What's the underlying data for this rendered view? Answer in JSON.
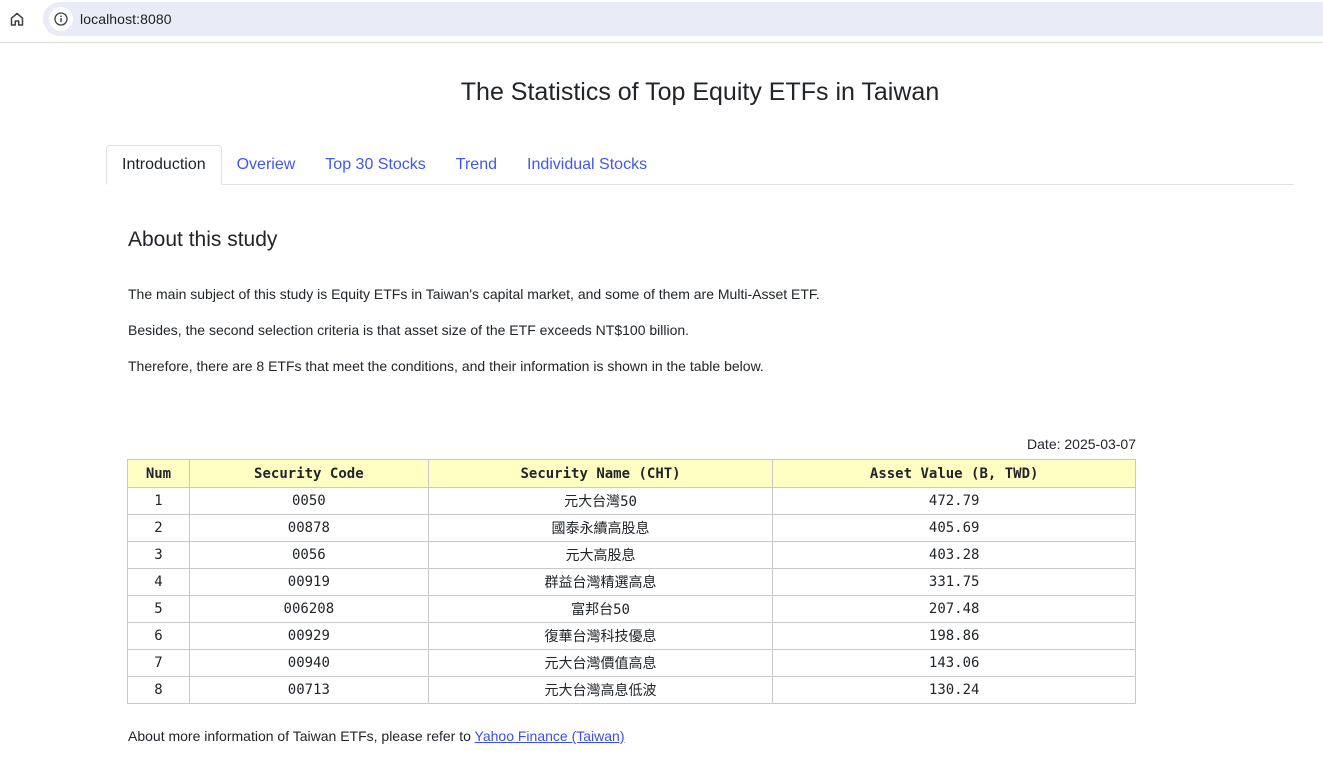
{
  "browser": {
    "url": "localhost:8080",
    "home_icon": "home-icon",
    "info_icon": "info-icon"
  },
  "page": {
    "title": "The Statistics of Top Equity ETFs in Taiwan"
  },
  "tabs": [
    {
      "label": "Introduction",
      "active": true
    },
    {
      "label": "Overiew",
      "active": false
    },
    {
      "label": "Top 30 Stocks",
      "active": false
    },
    {
      "label": "Trend",
      "active": false
    },
    {
      "label": "Individual Stocks",
      "active": false
    }
  ],
  "about": {
    "heading": "About this study",
    "p1": "The main subject of this study is Equity ETFs in Taiwan's capital market, and some of them are Multi-Asset ETF.",
    "p2": "Besides, the second selection criteria is that asset size of the ETF exceeds NT$100 billion.",
    "p3": "Therefore, there are 8 ETFs that meet the conditions, and their information is shown in the table below."
  },
  "table": {
    "date": "Date: 2025-03-07",
    "headers": [
      "Num",
      "Security Code",
      "Security Name (CHT)",
      "Asset Value (B, TWD)"
    ],
    "rows": [
      [
        "1",
        "0050",
        "元大台灣50",
        "472.79"
      ],
      [
        "2",
        "00878",
        "國泰永續高股息",
        "405.69"
      ],
      [
        "3",
        "0056",
        "元大高股息",
        "403.28"
      ],
      [
        "4",
        "00919",
        "群益台灣精選高息",
        "331.75"
      ],
      [
        "5",
        "006208",
        "富邦台50",
        "207.48"
      ],
      [
        "6",
        "00929",
        "復華台灣科技優息",
        "198.86"
      ],
      [
        "7",
        "00940",
        "元大台灣價值高息",
        "143.06"
      ],
      [
        "8",
        "00713",
        "元大台灣高息低波",
        "130.24"
      ]
    ]
  },
  "footer": {
    "text": "About more information of Taiwan ETFs, please refer to ",
    "link": "Yahoo Finance (Taiwan)"
  },
  "colors": {
    "link": "#4257e8",
    "header_bg": "#ffffc4",
    "url_bar_bg": "#e9ecf6"
  }
}
